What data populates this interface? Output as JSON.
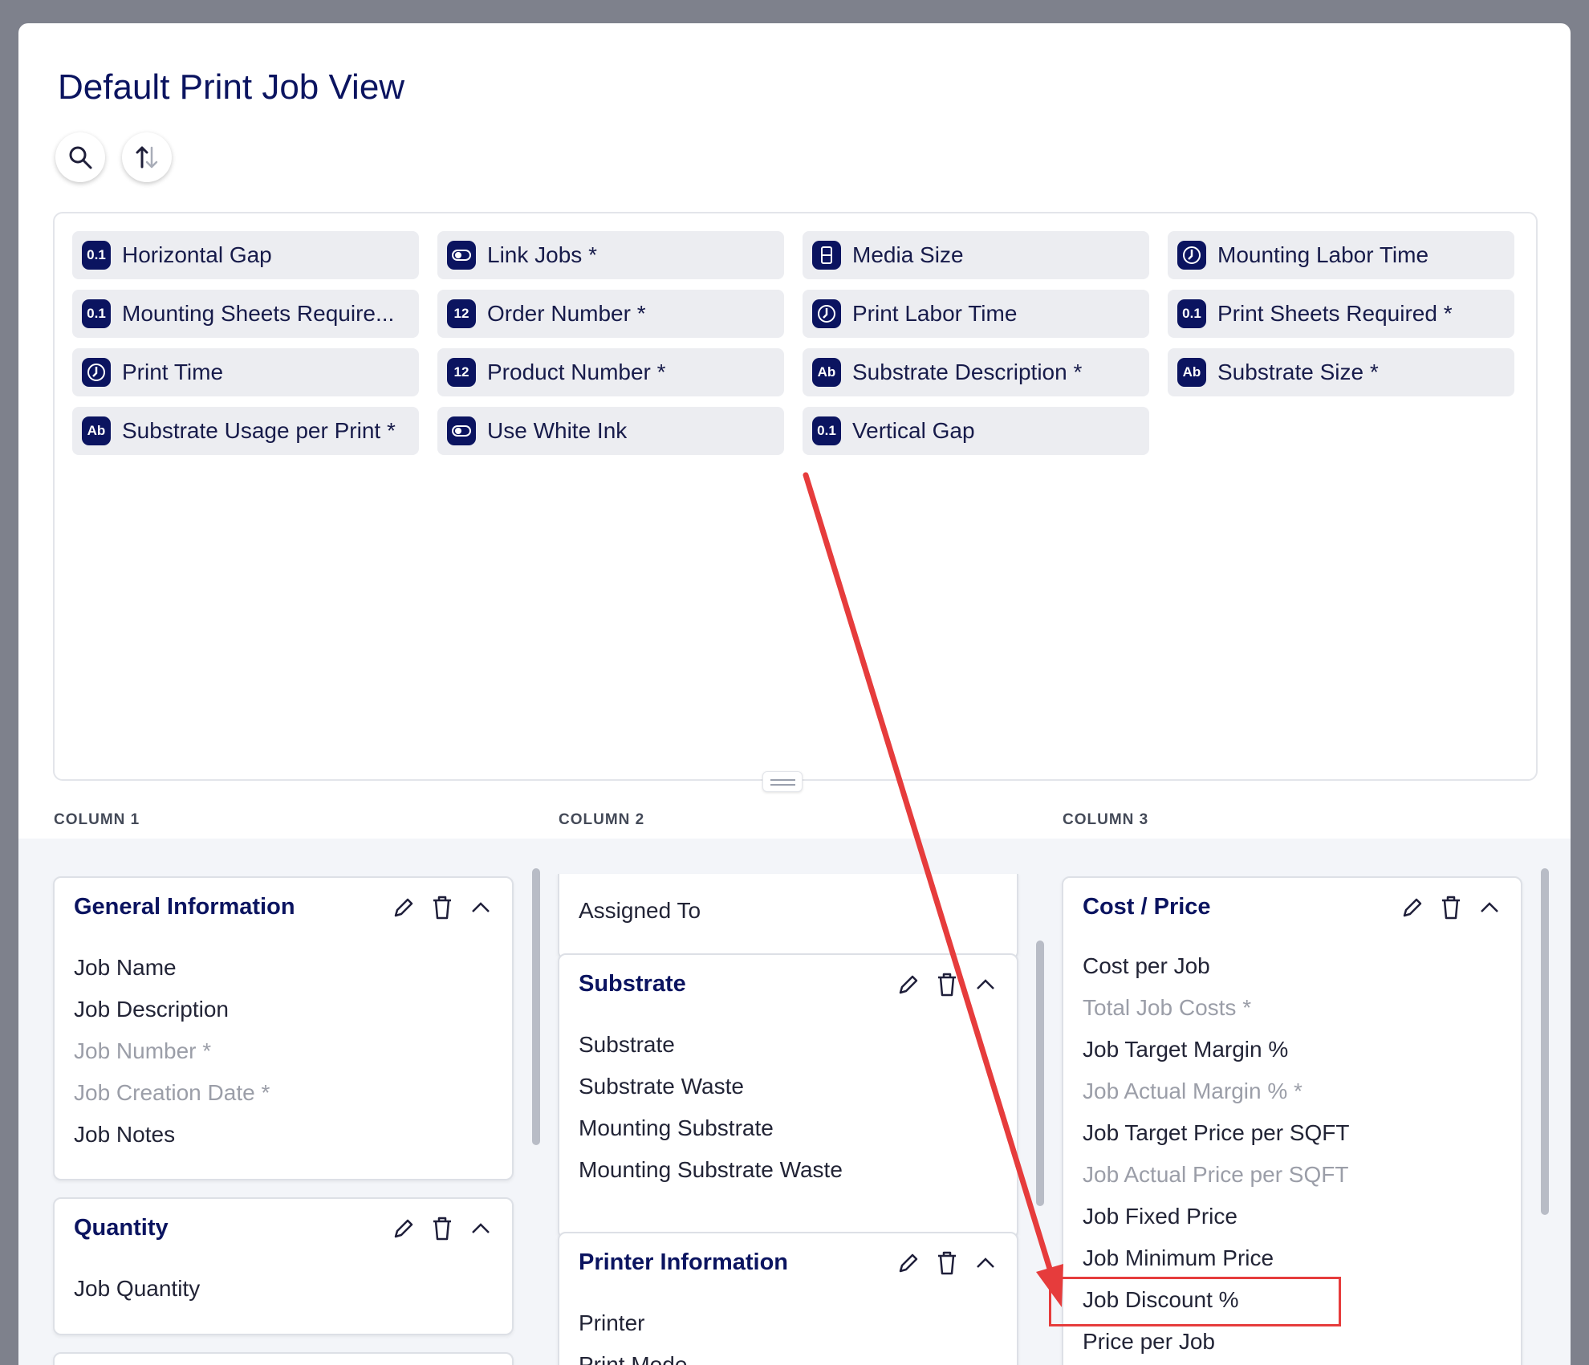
{
  "page": {
    "title": "Default Print Job View"
  },
  "toolbar": {
    "search_icon": "search-icon",
    "sort_icon": "sort-icon"
  },
  "field_pool": [
    {
      "label": "Horizontal Gap",
      "type": "0.1"
    },
    {
      "label": "Link Jobs *",
      "type": "toggle"
    },
    {
      "label": "Media Size",
      "type": "media"
    },
    {
      "label": "Mounting Labor Time",
      "type": "clock"
    },
    {
      "label": "Mounting Sheets Require...",
      "type": "0.1"
    },
    {
      "label": "Order Number *",
      "type": "12"
    },
    {
      "label": "Print Labor Time",
      "type": "clock"
    },
    {
      "label": "Print Sheets Required *",
      "type": "0.1"
    },
    {
      "label": "Print Time",
      "type": "clock"
    },
    {
      "label": "Product Number *",
      "type": "12"
    },
    {
      "label": "Substrate Description *",
      "type": "Ab"
    },
    {
      "label": "Substrate Size *",
      "type": "Ab"
    },
    {
      "label": "Substrate Usage per Print *",
      "type": "Ab"
    },
    {
      "label": "Use White Ink",
      "type": "toggle"
    },
    {
      "label": "Vertical Gap",
      "type": "0.1"
    }
  ],
  "columns": [
    "COLUMN 1",
    "COLUMN 2",
    "COLUMN 3"
  ],
  "col1": {
    "general": {
      "title": "General Information",
      "items": [
        "Job Name",
        "Job Description",
        "Job Number *",
        "Job Creation Date *",
        "Job Notes"
      ]
    },
    "quantity": {
      "title": "Quantity",
      "items": [
        "Job Quantity"
      ]
    }
  },
  "col2": {
    "assigned": {
      "items": [
        "Assigned To"
      ]
    },
    "substrate": {
      "title": "Substrate",
      "items": [
        "Substrate",
        "Substrate Waste",
        "Mounting Substrate",
        "Mounting Substrate Waste"
      ]
    },
    "printer": {
      "title": "Printer Information",
      "items": [
        "Printer",
        "Print Mode"
      ]
    }
  },
  "col3": {
    "cost": {
      "title": "Cost / Price",
      "items": [
        "Cost per Job",
        "Total Job Costs *",
        "Job Target Margin %",
        "Job Actual Margin % *",
        "Job Target Price per SQFT",
        "Job Actual Price per SQFT",
        "Job Fixed Price",
        "Job Minimum Price",
        "Job Discount %",
        "Price per Job"
      ]
    }
  },
  "colors": {
    "accent": "#0b1460",
    "annotation": "#e63c3c",
    "muted": "#9b9ea8"
  }
}
